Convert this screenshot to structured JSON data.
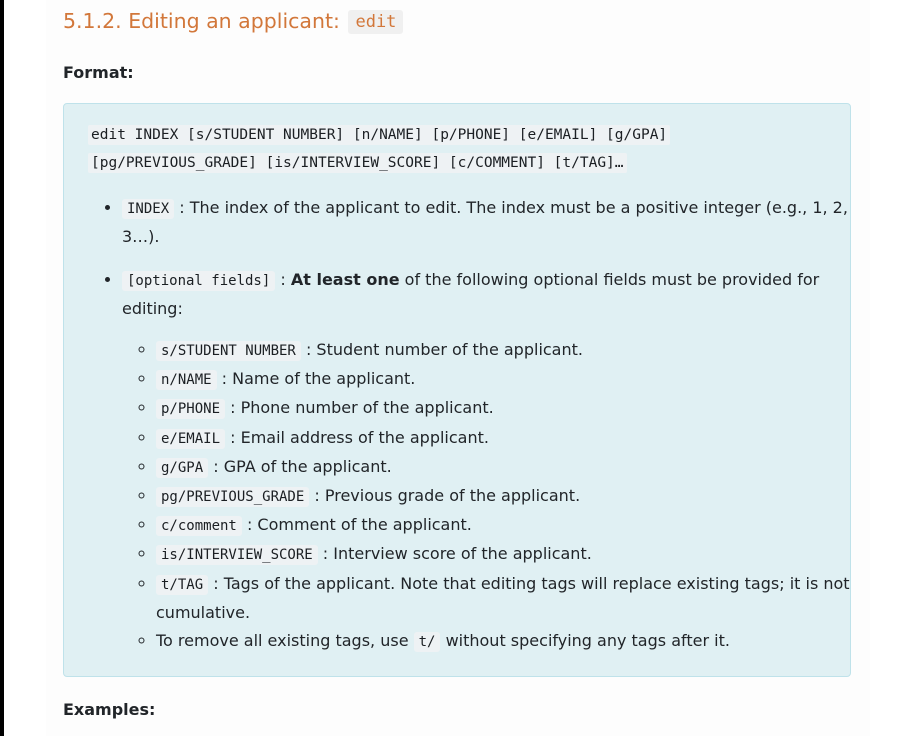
{
  "heading": {
    "text": "5.1.2. Editing an applicant:",
    "code": "edit"
  },
  "format_label": "Format:",
  "command_line1": "edit INDEX [s/STUDENT NUMBER] [n/NAME] [p/PHONE] [e/EMAIL] [g/GPA]",
  "command_line2": "[pg/PREVIOUS_GRADE] [is/INTERVIEW_SCORE] [c/COMMENT] [t/TAG]…",
  "bullets": [
    {
      "code": "INDEX",
      "text": " : The index of the applicant to edit. The index must be a positive integer (e.g., 1, 2, 3…)."
    },
    {
      "code": "[optional fields]",
      "text_pre": " : ",
      "bold": "At least one",
      "text_post": " of the following optional fields must be provided for editing:"
    }
  ],
  "sub_items": [
    {
      "code": "s/STUDENT NUMBER",
      "text": " : Student number of the applicant."
    },
    {
      "code": "n/NAME",
      "text": " : Name of the applicant."
    },
    {
      "code": "p/PHONE",
      "text": " : Phone number of the applicant."
    },
    {
      "code": "e/EMAIL",
      "text": " : Email address of the applicant."
    },
    {
      "code": "g/GPA",
      "text": " : GPA of the applicant."
    },
    {
      "code": "pg/PREVIOUS_GRADE",
      "text": " : Previous grade of the applicant."
    },
    {
      "code": "c/comment",
      "text": " : Comment of the applicant."
    },
    {
      "code": "is/INTERVIEW_SCORE",
      "text": " : Interview score of the applicant."
    },
    {
      "code": "t/TAG",
      "text": " : Tags of the applicant. Note that editing tags will replace existing tags; it is not cumulative."
    }
  ],
  "remove_tags": {
    "pre": "To remove all existing tags, use ",
    "code": "t/",
    "post": " without specifying any tags after it."
  },
  "examples_label": "Examples:"
}
